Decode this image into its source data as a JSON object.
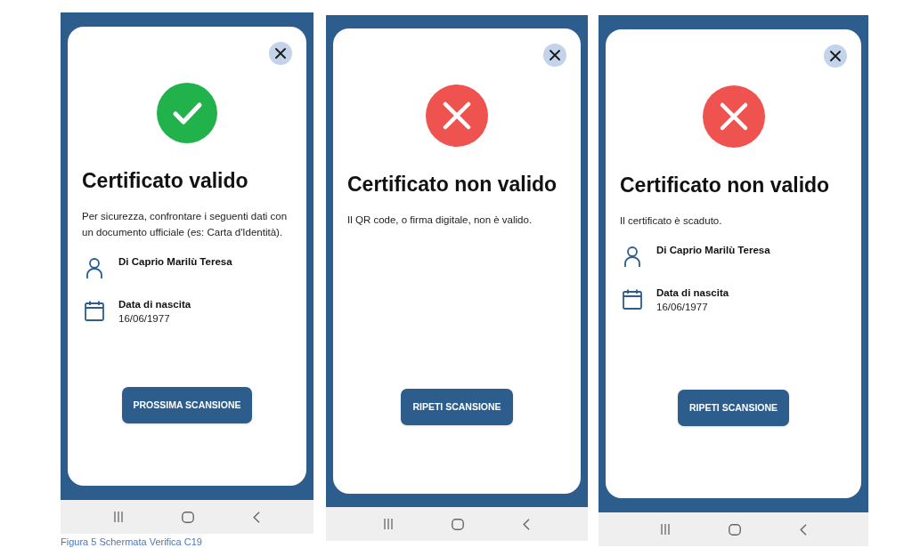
{
  "screens": [
    {
      "kind": "valid",
      "title": "Certificato valido",
      "message": "Per sicurezza, confrontare i seguenti dati con un documento ufficiale (es: Carta d'Identità).",
      "fields": [
        {
          "kind": "person",
          "value": "Di Caprio Marilù Teresa"
        },
        {
          "kind": "date",
          "label": "Data di nascita",
          "value": "16/06/1977"
        }
      ],
      "button": "PROSSIMA SCANSIONE"
    },
    {
      "kind": "invalid",
      "title": "Certificato non valido",
      "message": "Il QR code, o firma digitale, non è valido.",
      "button": "RIPETI SCANSIONE"
    },
    {
      "kind": "invalid",
      "title": "Certificato non valido",
      "message": "Il certificato è scaduto.",
      "fields": [
        {
          "kind": "person",
          "value": "Di Caprio Marilù Teresa"
        },
        {
          "kind": "date",
          "label": "Data di nascita",
          "value": "16/06/1977"
        }
      ],
      "button": "RIPETI SCANSIONE"
    }
  ],
  "caption": "Figura 5 Schermata Verifica C19"
}
